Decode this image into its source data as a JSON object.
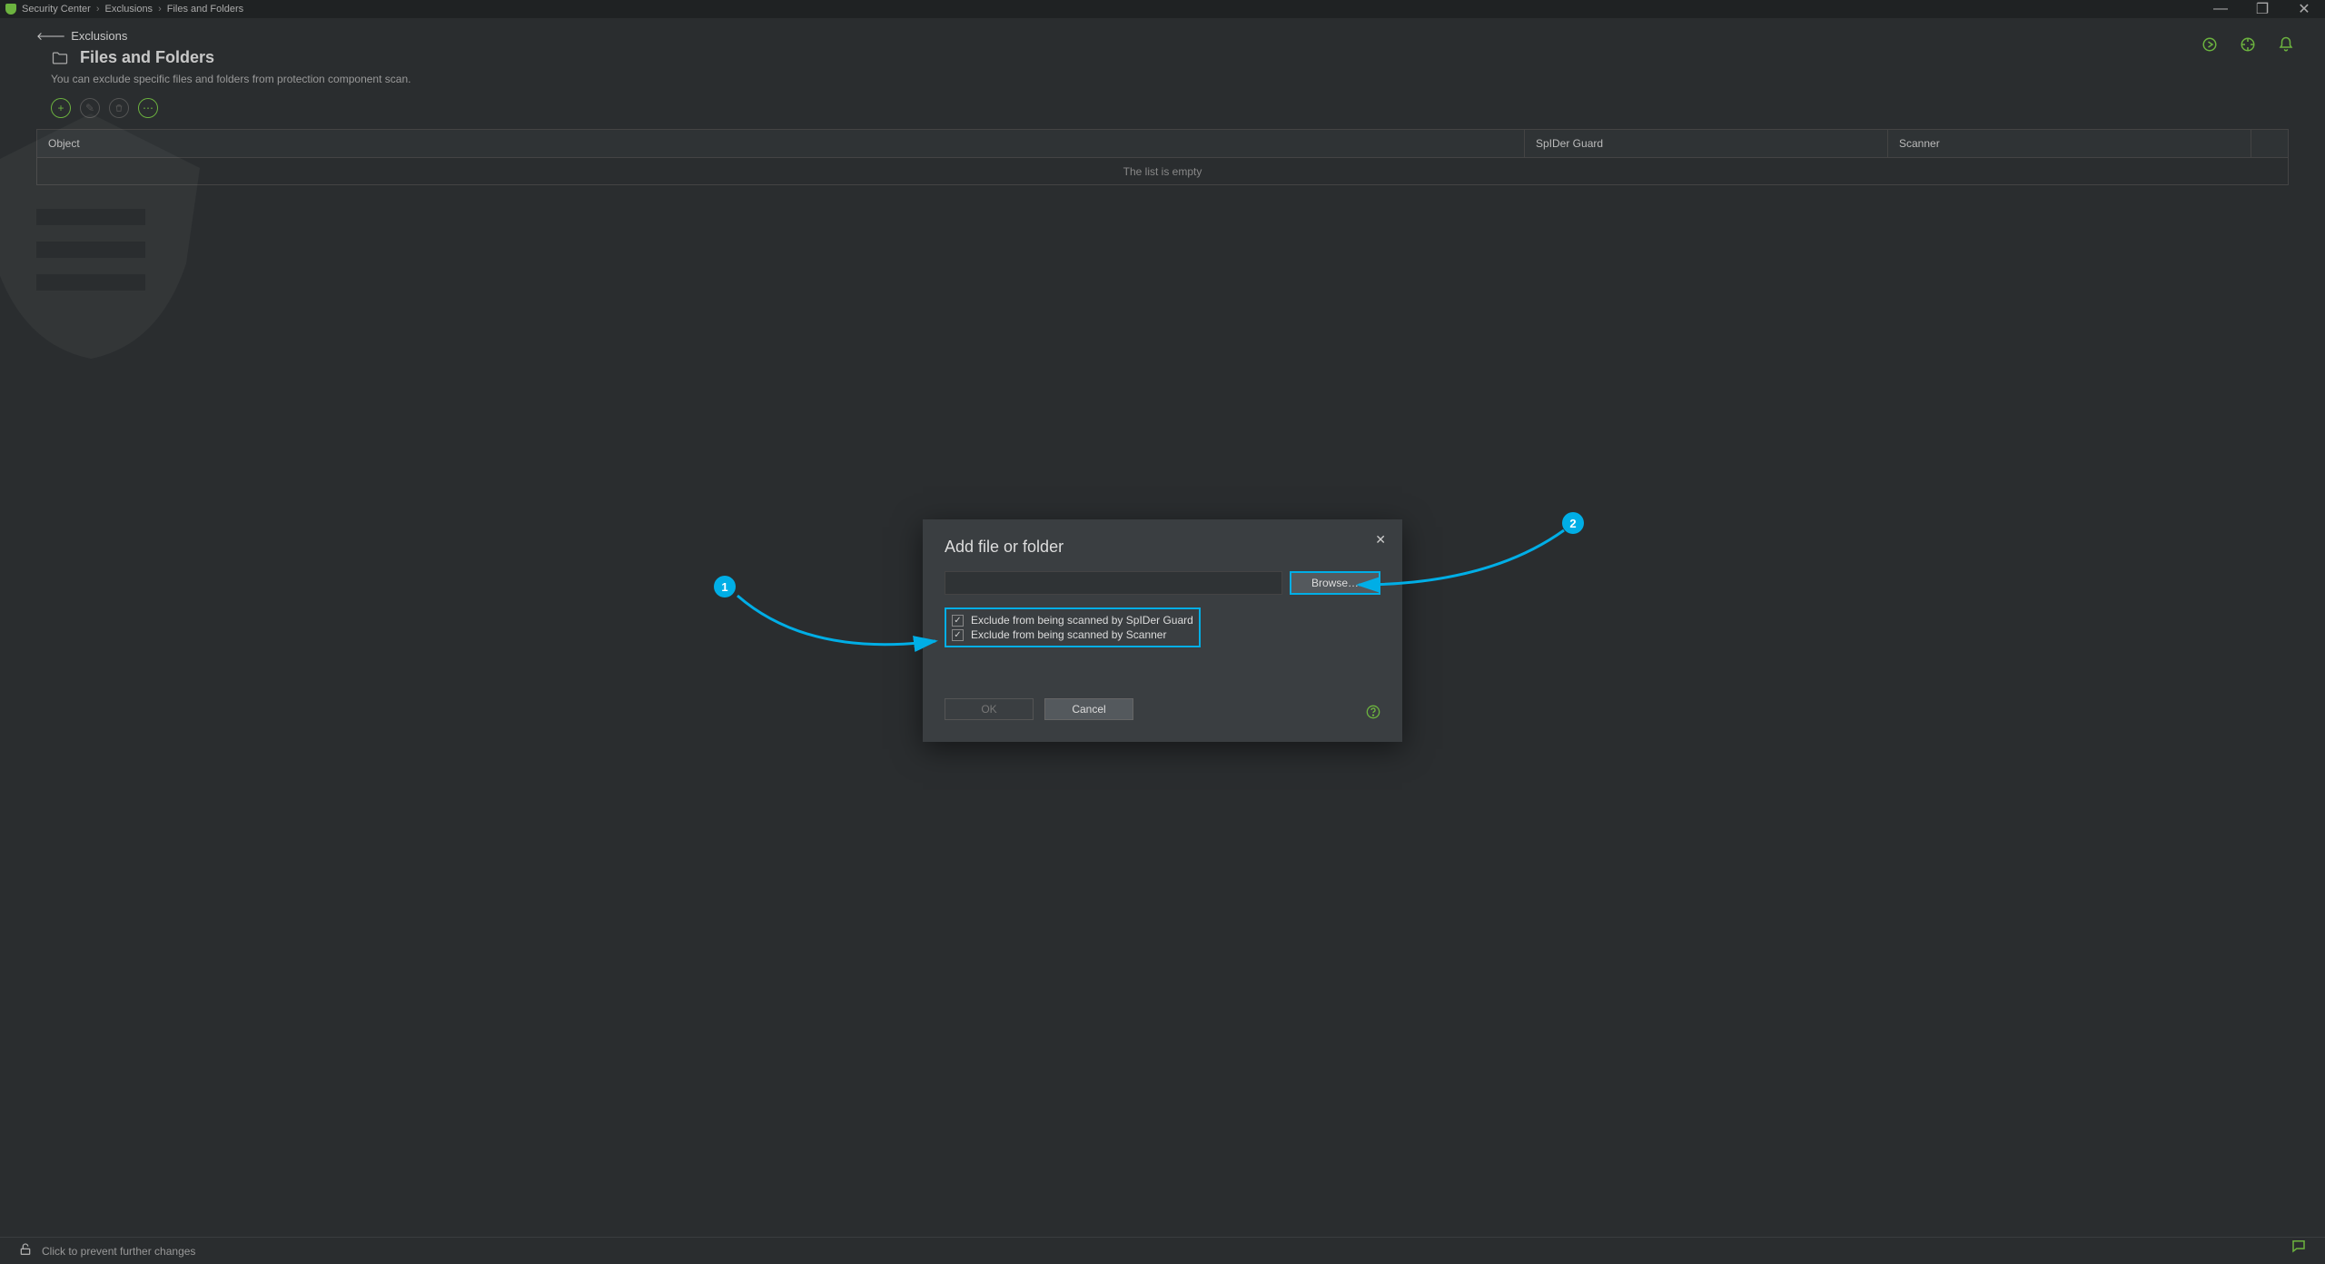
{
  "window": {
    "breadcrumb": [
      "Security Center",
      "Exclusions",
      "Files and Folders"
    ],
    "minimize": "—",
    "maximize": "❐",
    "close": "✕"
  },
  "back_link": "Exclusions",
  "page": {
    "title": "Files and Folders",
    "subtitle": "You can exclude specific files and folders from protection component scan."
  },
  "table": {
    "columns": {
      "object": "Object",
      "spider": "SpIDer Guard",
      "scanner": "Scanner"
    },
    "empty": "The list is empty"
  },
  "footer": {
    "lock_text": "Click to prevent further changes"
  },
  "dialog": {
    "title": "Add file or folder",
    "browse": "Browse…",
    "opt_spider": "Exclude from being scanned by SpIDer Guard",
    "opt_scanner": "Exclude from being scanned by Scanner",
    "ok": "OK",
    "cancel": "Cancel"
  },
  "callouts": {
    "one": "1",
    "two": "2"
  },
  "icons": {
    "folder": "folder-icon",
    "add": "+",
    "edit": "✎",
    "delete": "🗑",
    "more": "⋯",
    "scan": "scan-icon",
    "support": "support-icon",
    "notify": "bell-icon",
    "help": "?",
    "chat": "💬"
  }
}
